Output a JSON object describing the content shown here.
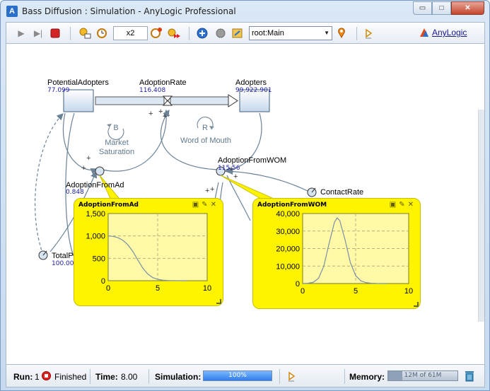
{
  "window": {
    "title": "Bass Diffusion : Simulation - AnyLogic Professional",
    "app_icon": "anylogic-logo-icon",
    "controls": {
      "minimize": "▭",
      "maximize": "□",
      "close": "✕"
    }
  },
  "toolbar": {
    "buttons": [
      "run-icon",
      "step-icon",
      "stop-icon",
      "slow-down-icon",
      "speed-up-icon",
      "realtime-icon",
      "fast-forward-icon",
      "navigate-icon",
      "camera-icon",
      "home-icon",
      "locate-icon",
      "experiment-icon"
    ],
    "speed": "x2",
    "view": "root:Main",
    "brand": "AnyLogic"
  },
  "model": {
    "stocks": [
      {
        "name": "PotentialAdopters",
        "value": "77.099"
      },
      {
        "name": "Adopters",
        "value": "99,922.901"
      }
    ],
    "flow": {
      "name": "AdoptionRate",
      "value": "116.408"
    },
    "variables": [
      {
        "name": "AdoptionFromAd",
        "value": "0.848"
      },
      {
        "name": "AdoptionFromWOM",
        "value": "115.56"
      },
      {
        "name": "ContactRate",
        "value": ""
      },
      {
        "name": "TotalP",
        "value": "100.000"
      }
    ],
    "loops": [
      {
        "letter": "B",
        "label_line1": "Market",
        "label_line2": "Saturation"
      },
      {
        "letter": "R",
        "label_line1": "Word of Mouth",
        "label_line2": ""
      }
    ],
    "signs": [
      "+",
      "+",
      "+",
      "+",
      "+",
      "+",
      "+",
      "+",
      "+"
    ]
  },
  "charts": [
    {
      "title": "AdoptionFromAd",
      "icons": [
        "window-icon",
        "edit-icon",
        "close-icon"
      ],
      "chart_data": {
        "type": "line",
        "title": "AdoptionFromAd",
        "xlabel": "",
        "ylabel": "",
        "xlim": [
          0,
          10
        ],
        "ylim": [
          0,
          1500
        ],
        "xticks": [
          "0",
          "5",
          "10"
        ],
        "yticks": [
          "0",
          "500",
          "1,000",
          "1,500"
        ],
        "grid": true,
        "series": [
          {
            "x": [
              0,
              0.5,
              1,
              1.5,
              2,
              2.5,
              3,
              3.5,
              4,
              4.5,
              5,
              5.5,
              6,
              6.5,
              7,
              7.5,
              8
            ],
            "y": [
              1000,
              990,
              960,
              900,
              800,
              650,
              460,
              280,
              150,
              70,
              30,
              12,
              5,
              2,
              1,
              0,
              0
            ]
          }
        ]
      }
    },
    {
      "title": "AdoptionFromWOM",
      "icons": [
        "window-icon",
        "edit-icon",
        "close-icon"
      ],
      "chart_data": {
        "type": "line",
        "title": "AdoptionFromWOM",
        "xlabel": "",
        "ylabel": "",
        "xlim": [
          0,
          10
        ],
        "ylim": [
          0,
          40000
        ],
        "xticks": [
          "0",
          "5",
          "10"
        ],
        "yticks": [
          "0",
          "10,000",
          "20,000",
          "30,000",
          "40,000"
        ],
        "grid": true,
        "series": [
          {
            "x": [
              0,
              0.5,
              1,
              1.5,
              2,
              2.5,
              3,
              3.25,
              3.5,
              4,
              4.5,
              5,
              5.5,
              6,
              6.5,
              7,
              8
            ],
            "y": [
              0,
              150,
              700,
              3000,
              10000,
              23000,
              35000,
              37500,
              36000,
              25000,
              12000,
              4500,
              1500,
              500,
              150,
              50,
              0
            ]
          }
        ]
      }
    }
  ],
  "status": {
    "run_label": "Run:",
    "run_value": "1",
    "state": "Finished",
    "time_label": "Time:",
    "time_value": "8.00",
    "simulation_label": "Simulation:",
    "simulation_progress": "100%",
    "simulation_fraction": 1.0,
    "memory_label": "Memory:",
    "memory_value": "12M of 61M",
    "memory_fraction": 0.2
  }
}
